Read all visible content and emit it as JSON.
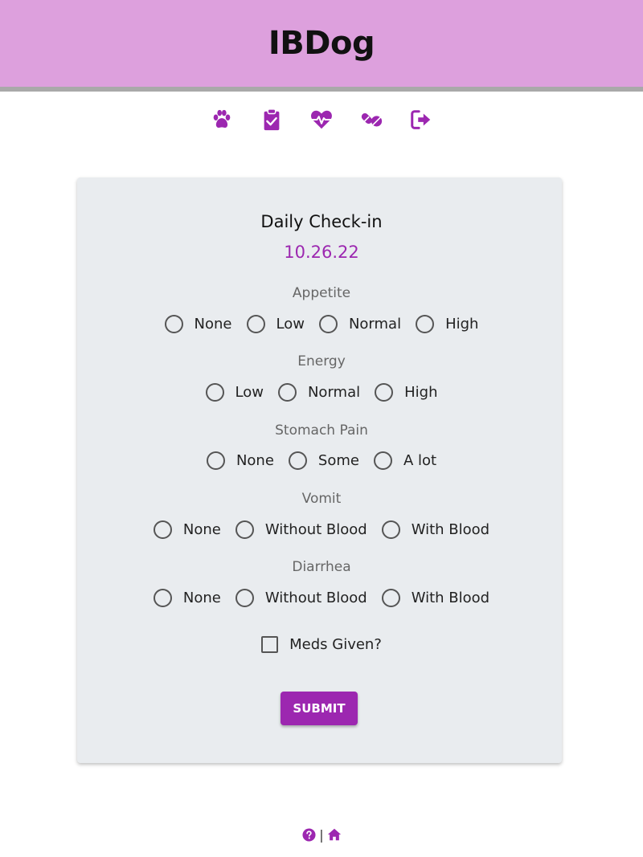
{
  "header": {
    "title": "IBDog"
  },
  "nav": {
    "items": [
      {
        "icon": "paw-icon"
      },
      {
        "icon": "clipboard-check-icon"
      },
      {
        "icon": "heart-pulse-icon"
      },
      {
        "icon": "pills-icon"
      },
      {
        "icon": "logout-icon"
      }
    ],
    "accent_color": "#9c27b0"
  },
  "form": {
    "title": "Daily Check-in",
    "date": "10.26.22",
    "questions": [
      {
        "label": "Appetite",
        "options": [
          "None",
          "Low",
          "Normal",
          "High"
        ]
      },
      {
        "label": "Energy",
        "options": [
          "Low",
          "Normal",
          "High"
        ]
      },
      {
        "label": "Stomach Pain",
        "options": [
          "None",
          "Some",
          "A lot"
        ]
      },
      {
        "label": "Vomit",
        "options": [
          "None",
          "Without Blood",
          "With Blood"
        ]
      },
      {
        "label": "Diarrhea",
        "options": [
          "None",
          "Without Blood",
          "With Blood"
        ]
      }
    ],
    "meds_label": "Meds Given?",
    "meds_checked": false,
    "submit_label": "SUBMIT"
  },
  "footer": {
    "help_icon": "question-circle-icon",
    "separator": "|",
    "home_icon": "home-icon"
  },
  "colors": {
    "header_bg": "#dda0dd",
    "header_rule": "#a9a9a9",
    "card_bg": "#e9ecef",
    "accent": "#9c27b0"
  }
}
